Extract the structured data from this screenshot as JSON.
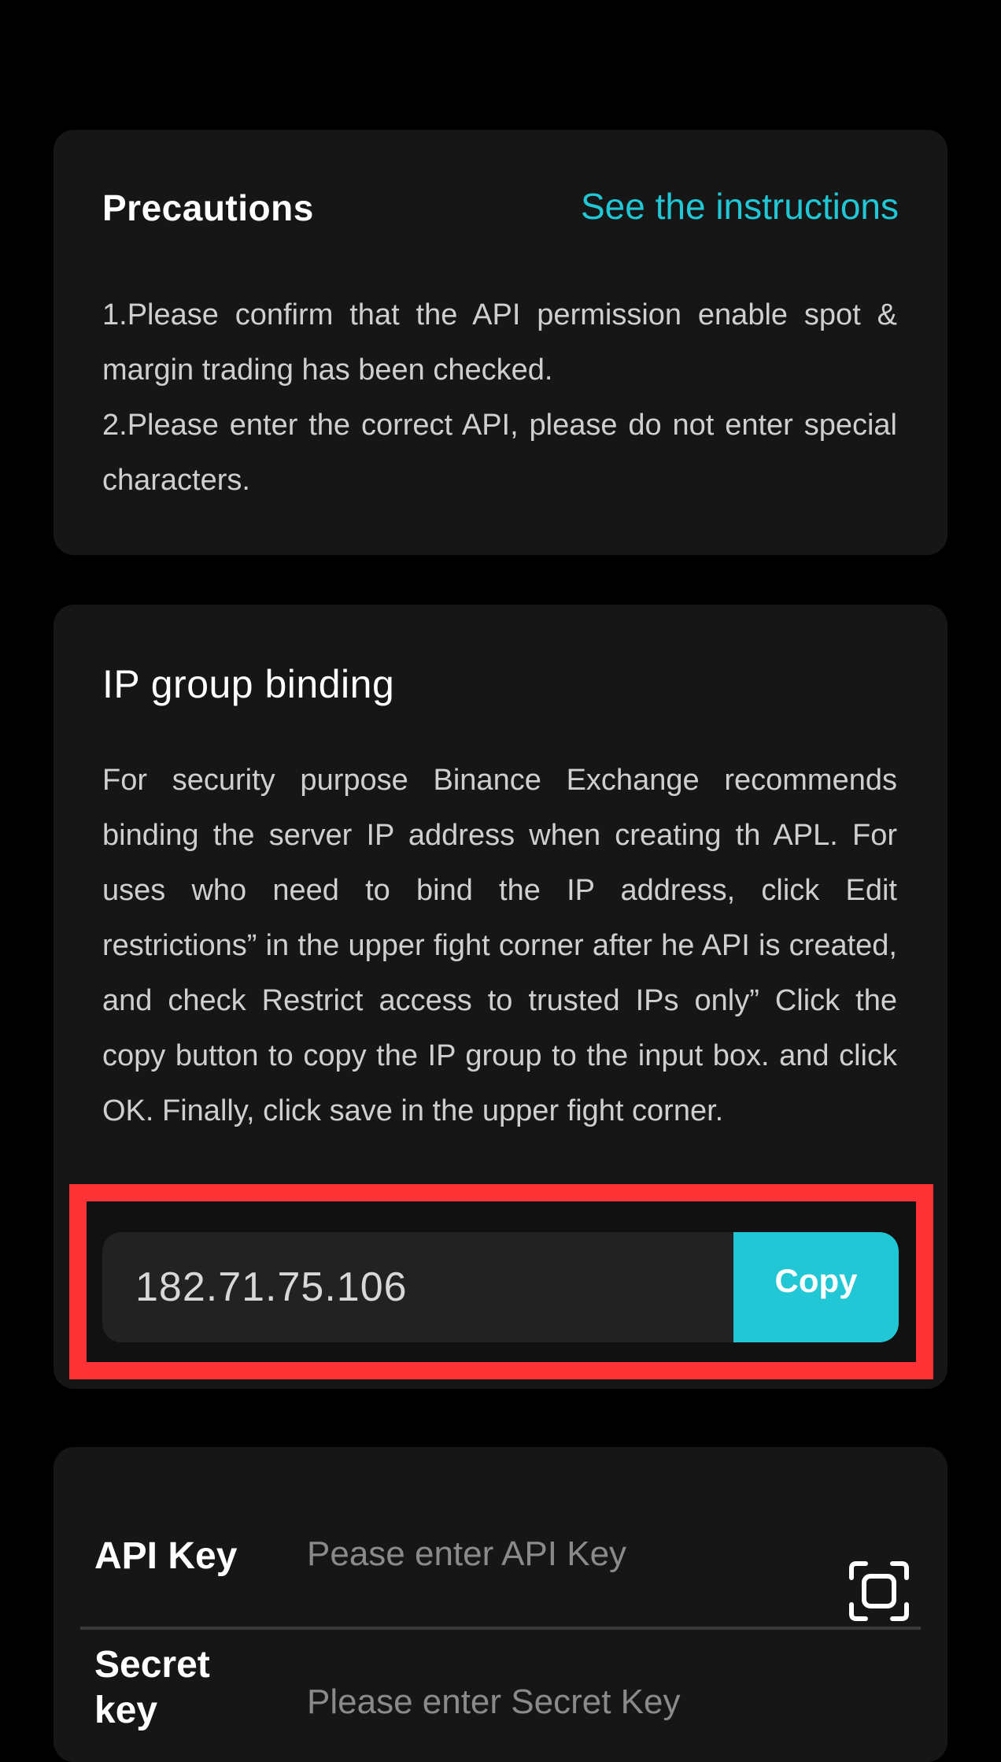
{
  "precautions": {
    "title": "Precautions",
    "link_label": "See the instructions",
    "lines": [
      "1.Please confirm that the API permission enable spot & margin trading has been checked.",
      "2.Please enter the correct API, please do not enter special characters."
    ]
  },
  "ip_binding": {
    "title": "IP group binding",
    "description": "For security purpose Binance Exchange recommends binding the server IP address when creating th APL. For uses who need to bind the IP address, click Edit restrictions” in the upper fight corner after he API is created, and check Restrict access to trusted IPs only” Click the copy button to copy the IP group to the input box. and click OK. Finally, click save in the upper fight corner.",
    "ip_value": "182.71.75.106",
    "copy_label": "Copy"
  },
  "api_form": {
    "api_key_label": "API Key",
    "api_key_placeholder": "Pease enter API Key",
    "secret_key_label": "Secret key",
    "secret_key_placeholder": "Please enter Secret Key",
    "scan_icon": "scan-icon"
  },
  "colors": {
    "accent": "#22c7d6",
    "highlight": "#ff3236",
    "card_bg": "#161616",
    "page_bg": "#000000"
  }
}
